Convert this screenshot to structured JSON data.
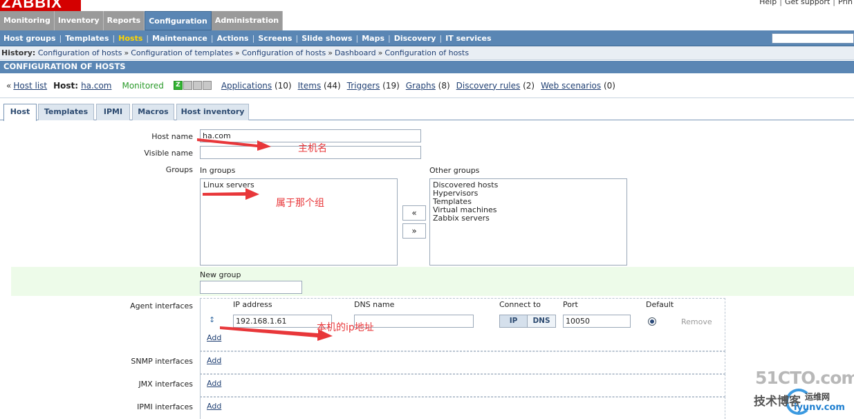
{
  "header": {
    "logo_text": "ZABBIX",
    "top_links": [
      "Help",
      "Get support",
      "Prin"
    ]
  },
  "main_menu": [
    "Monitoring",
    "Inventory",
    "Reports",
    "Configuration",
    "Administration"
  ],
  "main_menu_active": "Configuration",
  "sub_menu": [
    "Host groups",
    "Templates",
    "Hosts",
    "Maintenance",
    "Actions",
    "Screens",
    "Slide shows",
    "Maps",
    "Discovery",
    "IT services"
  ],
  "sub_menu_active": "Hosts",
  "history": {
    "label": "History:",
    "items": [
      "Configuration of hosts",
      "Configuration of templates",
      "Configuration of hosts",
      "Dashboard",
      "Configuration of hosts"
    ]
  },
  "page_title": "CONFIGURATION OF HOSTS",
  "host_bar": {
    "host_list": "Host list",
    "host_label": "Host:",
    "host_name": "ha.com",
    "status": "Monitored",
    "availability": [
      "Z",
      "",
      "",
      ""
    ],
    "links": [
      {
        "label": "Applications",
        "count": "(10)"
      },
      {
        "label": "Items",
        "count": "(44)"
      },
      {
        "label": "Triggers",
        "count": "(19)"
      },
      {
        "label": "Graphs",
        "count": "(8)"
      },
      {
        "label": "Discovery rules",
        "count": "(2)"
      },
      {
        "label": "Web scenarios",
        "count": "(0)"
      }
    ]
  },
  "form_tabs": [
    "Host",
    "Templates",
    "IPMI",
    "Macros",
    "Host inventory"
  ],
  "form_tab_active": "Host",
  "form": {
    "host_name_label": "Host name",
    "host_name_value": "ha.com",
    "visible_name_label": "Visible name",
    "visible_name_value": "",
    "groups_label": "Groups",
    "in_groups_label": "In groups",
    "in_groups": [
      "Linux servers"
    ],
    "other_groups_label": "Other groups",
    "other_groups": [
      "Discovered hosts",
      "Hypervisors",
      "Templates",
      "Virtual machines",
      "Zabbix servers"
    ],
    "move_left": "«",
    "move_right": "»",
    "new_group_label": "New group",
    "new_group_value": "",
    "agent_interfaces_label": "Agent interfaces",
    "col_ip": "IP address",
    "col_dns": "DNS name",
    "col_connect": "Connect to",
    "col_port": "Port",
    "col_default": "Default",
    "ip_value": "192.168.1.61",
    "dns_value": "",
    "connect_ip": "IP",
    "connect_dns": "DNS",
    "port_value": "10050",
    "remove": "Remove",
    "add": "Add",
    "snmp_label": "SNMP interfaces",
    "jmx_label": "JMX interfaces",
    "ipmi_label": "IPMI interfaces"
  },
  "annotations": {
    "host_name": "主机名",
    "group": "属于那个组",
    "ip": "本机的ip地址"
  },
  "watermark": {
    "line1": "51CTO.com",
    "line2": "技术博客",
    "line3": "运维网",
    "line4": "iyunv.com"
  },
  "colors": {
    "logo_red": "#d40000",
    "menu_blue": "#5a86b4",
    "menu_gray": "#9a9a9a",
    "active_submenu": "#ffd600",
    "monitored_green": "#2a9a2a",
    "annotation_red": "#e8373a",
    "new_group_row": "#edfbe9"
  }
}
